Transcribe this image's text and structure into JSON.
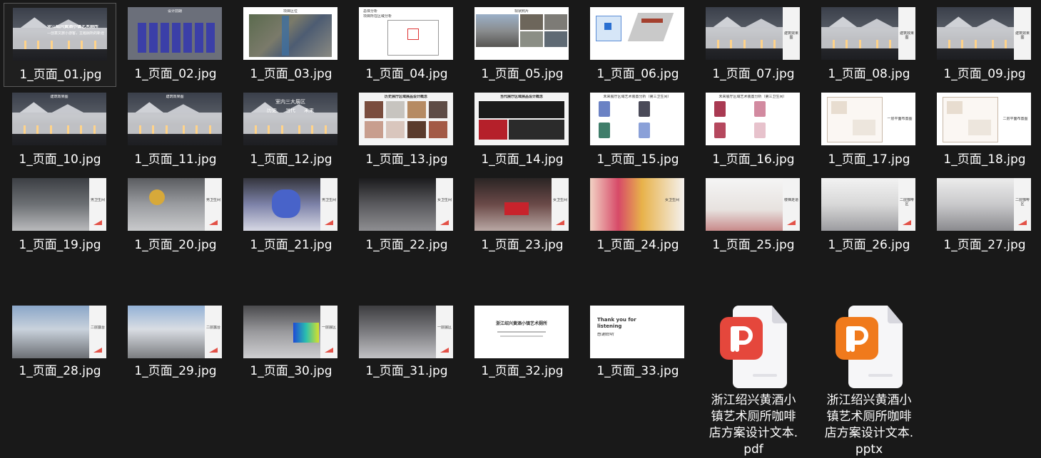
{
  "items": [
    {
      "file_name": "1_页面_01.jpg",
      "caption": "浙江绍兴黄酒小镇艺术厕所",
      "subcaption": "—创意文旅小游客，主题厕所的新诠释—",
      "selected": true
    },
    {
      "file_name": "1_页面_02.jpg",
      "caption": "设计前期"
    },
    {
      "file_name": "1_页面_03.jpg",
      "caption": "项目区位"
    },
    {
      "file_name": "1_页面_04.jpg",
      "caption": "总体分析",
      "subcaption": "项目所在区域分析"
    },
    {
      "file_name": "1_页面_05.jpg",
      "caption": "现状照片"
    },
    {
      "file_name": "1_页面_06.jpg",
      "caption": ""
    },
    {
      "file_name": "1_页面_07.jpg",
      "caption": "建筑效果图"
    },
    {
      "file_name": "1_页面_08.jpg",
      "caption": "建筑效果图"
    },
    {
      "file_name": "1_页面_09.jpg",
      "caption": "建筑效果图"
    },
    {
      "file_name": "1_页面_10.jpg",
      "caption": "建筑效果图"
    },
    {
      "file_name": "1_页面_11.jpg",
      "caption": "建筑效果图"
    },
    {
      "file_name": "1_页面_12.jpg",
      "caption": "室内三大展区",
      "words": [
        "历史",
        "当代",
        "未来"
      ]
    },
    {
      "file_name": "1_页面_13.jpg",
      "caption": "历史展厅区域展品设计概念"
    },
    {
      "file_name": "1_页面_14.jpg",
      "caption": "当代展厅区域展品设计概念"
    },
    {
      "file_name": "1_页面_15.jpg",
      "caption": "未来展厅区域艺术装置分析（第三卫生间）"
    },
    {
      "file_name": "1_页面_16.jpg",
      "caption": "未来展厅区域艺术装置分析（第三卫生间）"
    },
    {
      "file_name": "1_页面_17.jpg",
      "caption": "一层平面布置图"
    },
    {
      "file_name": "1_页面_18.jpg",
      "caption": "二层平面布置图"
    },
    {
      "file_name": "1_页面_19.jpg",
      "caption": "男卫生间"
    },
    {
      "file_name": "1_页面_20.jpg",
      "caption": "男卫生间"
    },
    {
      "file_name": "1_页面_21.jpg",
      "caption": "男卫生间"
    },
    {
      "file_name": "1_页面_22.jpg",
      "caption": "女卫生间"
    },
    {
      "file_name": "1_页面_23.jpg",
      "caption": "女卫生间"
    },
    {
      "file_name": "1_页面_24.jpg",
      "caption": "女卫生间"
    },
    {
      "file_name": "1_页面_25.jpg",
      "caption": "楼梯走道"
    },
    {
      "file_name": "1_页面_26.jpg",
      "caption": "二层咖啡区"
    },
    {
      "file_name": "1_页面_27.jpg",
      "caption": "二层咖啡区"
    },
    {
      "file_name": "1_页面_28.jpg",
      "caption": "二层露台"
    },
    {
      "file_name": "1_页面_29.jpg",
      "caption": "二层露台"
    },
    {
      "file_name": "1_页面_30.jpg",
      "caption": "一层展区"
    },
    {
      "file_name": "1_页面_31.jpg",
      "caption": "一层展区"
    },
    {
      "file_name": "1_页面_32.jpg",
      "caption": "浙江绍兴黄酒小镇艺术厕所"
    },
    {
      "file_name": "1_页面_33.jpg",
      "caption": "Thank you for listening",
      "subcaption": "感谢聆听"
    },
    {
      "file_name": "浙江绍兴黄酒小镇艺术厕所咖啡店方案设计文本.pdf",
      "label_lines": [
        "浙江绍兴黄酒小",
        "镇艺术厕所咖啡",
        "店方案设计文本.",
        "pdf"
      ],
      "icon": "pdf-file-icon"
    },
    {
      "file_name": "浙江绍兴黄酒小镇艺术厕所咖啡店方案设计文本.pptx",
      "label_lines": [
        "浙江绍兴黄酒小",
        "镇艺术厕所咖啡",
        "店方案设计文本.",
        "pptx"
      ],
      "icon": "pptx-file-icon"
    }
  ],
  "colors": {
    "background": "#191919",
    "pdf_badge": "#e5473c",
    "pptx_badge": "#f07a1c",
    "accent_triangle": "#e35248"
  }
}
